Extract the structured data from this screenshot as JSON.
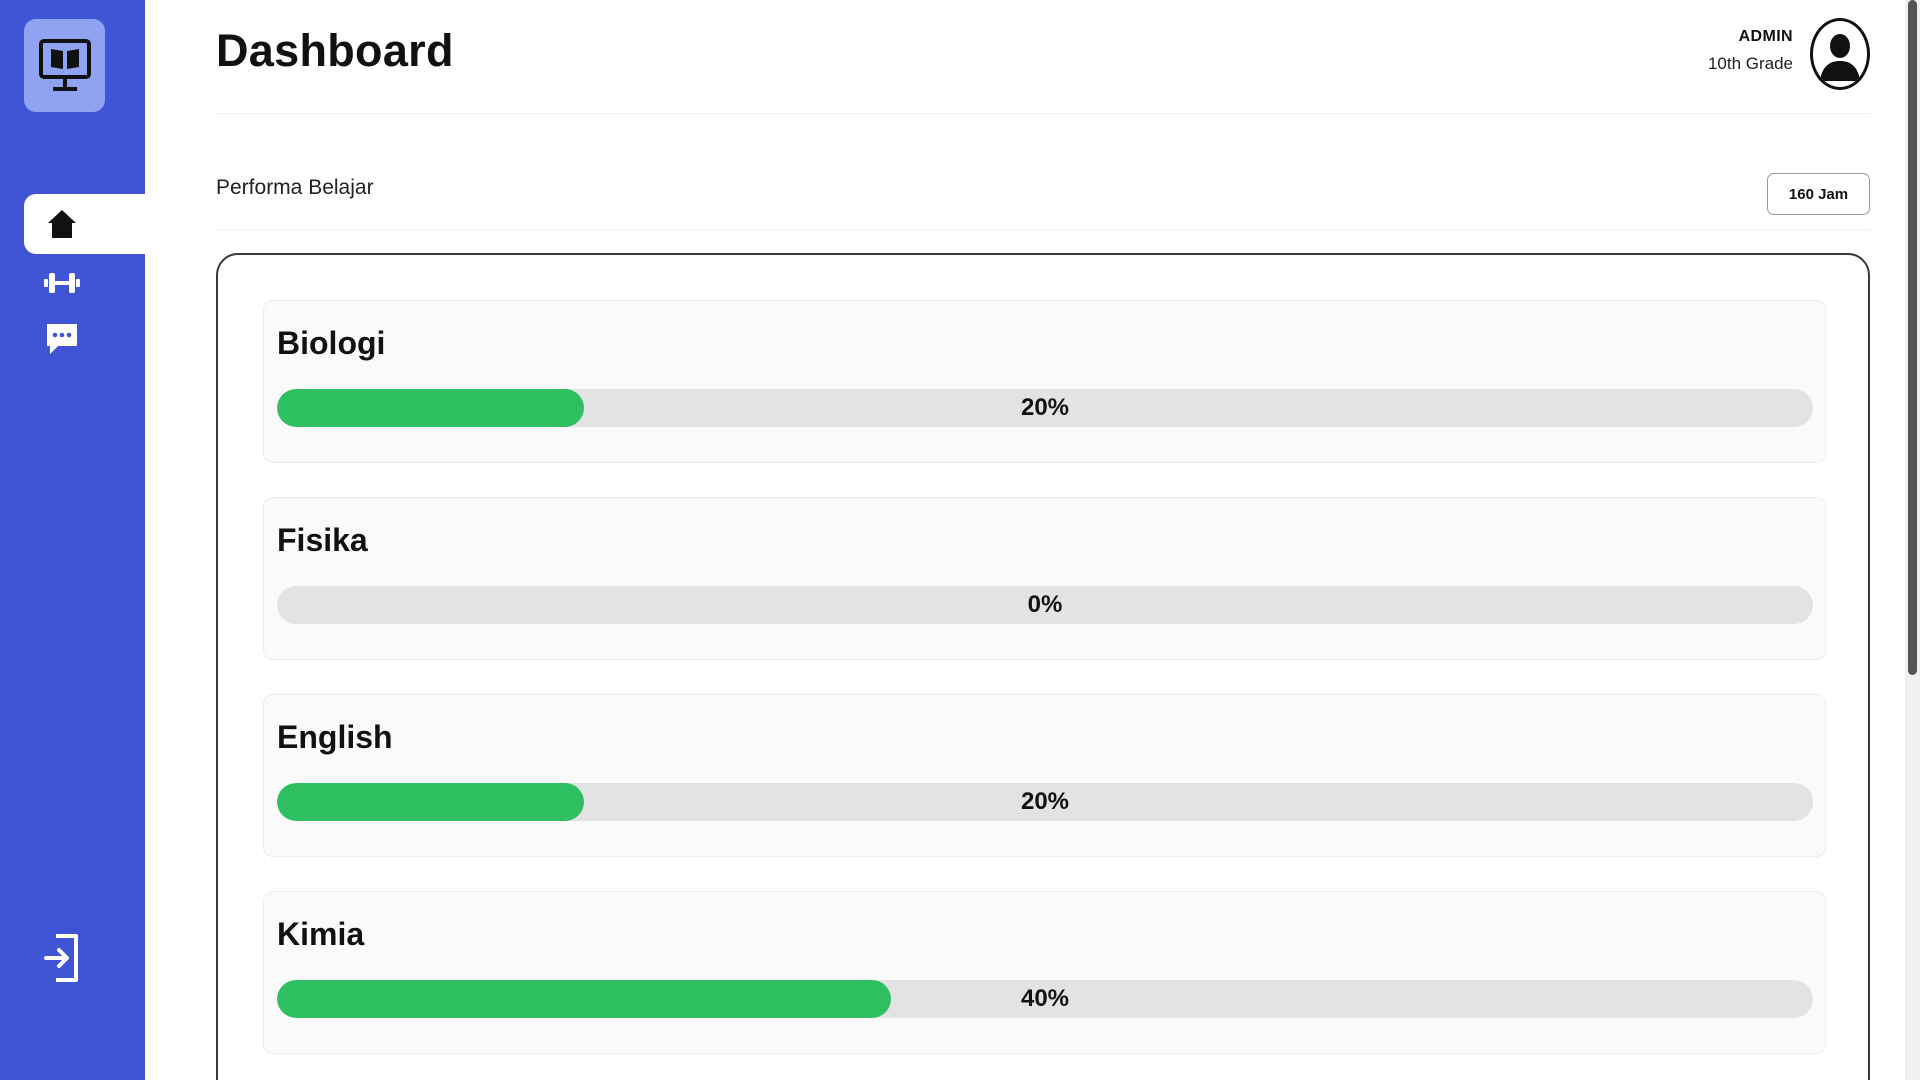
{
  "page": {
    "title": "Dashboard"
  },
  "user": {
    "name": "ADMIN",
    "grade": "10th Grade"
  },
  "section": {
    "label": "Performa Belajar",
    "hours_badge": "160 Jam"
  },
  "sidebar": {
    "logo_icon": "monitor-book-icon",
    "items": [
      {
        "icon": "home-icon",
        "active": true
      },
      {
        "icon": "dumbbell-icon",
        "active": false
      },
      {
        "icon": "chat-icon",
        "active": false
      }
    ],
    "logout_icon": "logout-icon"
  },
  "subjects": [
    {
      "name": "Biologi",
      "percent_label": "20%",
      "progress": 0.2
    },
    {
      "name": "Fisika",
      "percent_label": "0%",
      "progress": 0.0
    },
    {
      "name": "English",
      "percent_label": "20%",
      "progress": 0.2
    },
    {
      "name": "Kimia",
      "percent_label": "40%",
      "progress": 0.4
    }
  ],
  "colors": {
    "sidebar": "#3f55d6",
    "logo_bg": "#8fa3f2",
    "progress_fill": "#2ec060",
    "progress_track": "#e3e3e3"
  }
}
